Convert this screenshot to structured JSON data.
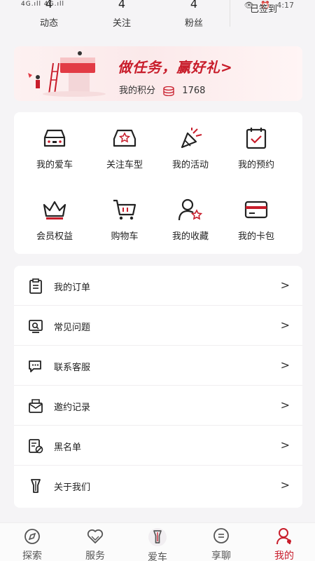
{
  "statusbar": {
    "signal": "4G.ıll 4G.ıll",
    "time": "4:17"
  },
  "stats": [
    {
      "num": "4",
      "label": "动态"
    },
    {
      "num": "4",
      "label": "关注"
    },
    {
      "num": "4",
      "label": "粉丝"
    }
  ],
  "signed_label": "已签到",
  "banner": {
    "slogan": "做任务，赢好礼>",
    "points_label": "我的积分",
    "points_value": "1768"
  },
  "grid": [
    {
      "label": "我的爱车",
      "icon": "car-icon"
    },
    {
      "label": "关注车型",
      "icon": "car-star-icon"
    },
    {
      "label": "我的活动",
      "icon": "party-popper-icon"
    },
    {
      "label": "我的预约",
      "icon": "calendar-check-icon"
    },
    {
      "label": "会员权益",
      "icon": "crown-icon"
    },
    {
      "label": "购物车",
      "icon": "cart-icon"
    },
    {
      "label": "我的收藏",
      "icon": "user-star-icon"
    },
    {
      "label": "我的卡包",
      "icon": "card-icon"
    }
  ],
  "list": [
    {
      "label": "我的订单",
      "icon": "clipboard-icon"
    },
    {
      "label": "常见问题",
      "icon": "search-screen-icon"
    },
    {
      "label": "联系客服",
      "icon": "chat-icon"
    },
    {
      "label": "邀约记录",
      "icon": "envelope-icon"
    },
    {
      "label": "黑名单",
      "icon": "blocked-list-icon"
    },
    {
      "label": "关于我们",
      "icon": "brand-logo-icon"
    }
  ],
  "chevron": ">",
  "tabs": [
    {
      "label": "探索",
      "icon": "compass-icon"
    },
    {
      "label": "服务",
      "icon": "heart-hands-icon"
    },
    {
      "label": "爱车",
      "icon": "brand-icon"
    },
    {
      "label": "享聊",
      "icon": "message-icon"
    },
    {
      "label": "我的",
      "icon": "user-icon"
    }
  ],
  "colors": {
    "accent": "#c81d2b",
    "background": "#f5f4f6",
    "card": "#ffffff"
  }
}
